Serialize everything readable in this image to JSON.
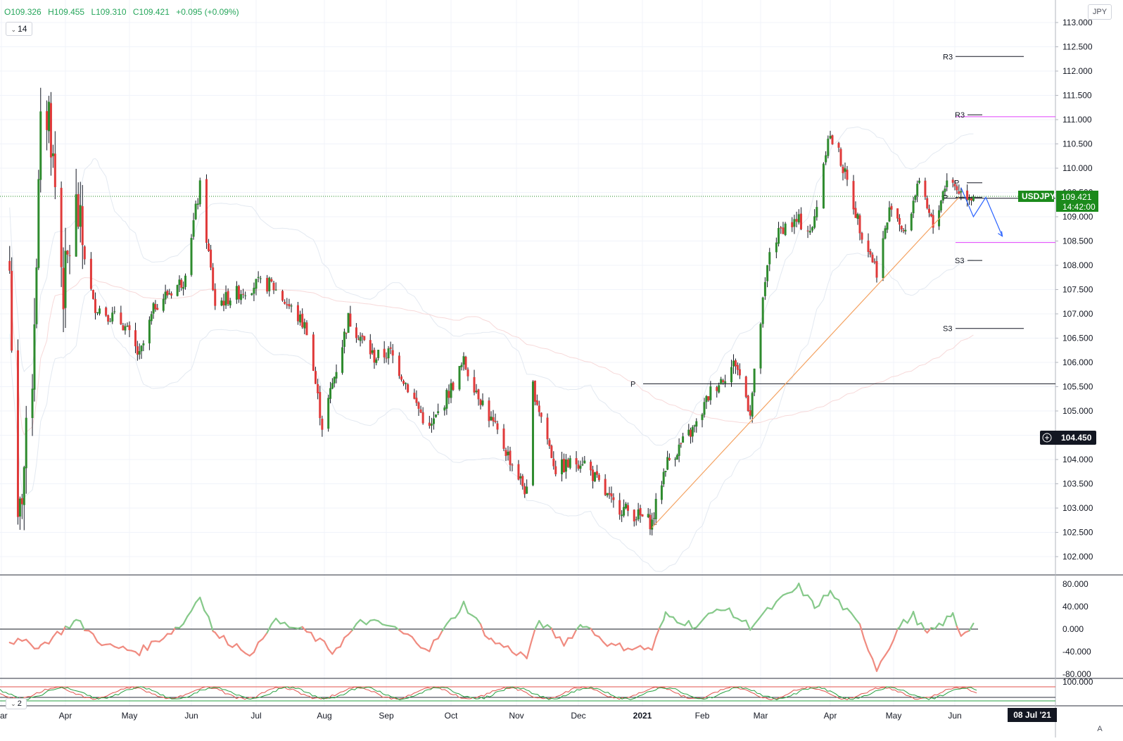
{
  "header": {
    "open": "O109.326",
    "high": "H109.455",
    "low": "L109.310",
    "close": "C109.421",
    "change": "+0.095 (+0.09%)",
    "period": "14",
    "currency": "JPY"
  },
  "colors": {
    "up": "#2e8b2e",
    "down": "#e03a3a",
    "trendline": "#f4a261",
    "projection": "#2962ff",
    "pivot_magenta": "#e040fb",
    "price_label_bg": "#1b8a1b",
    "rsi_up": "#86c98a",
    "rsi_down": "#f08b80"
  },
  "price_axis": {
    "ticks": [
      "113.000",
      "112.500",
      "112.000",
      "111.500",
      "111.000",
      "110.500",
      "110.000",
      "109.500",
      "109.000",
      "108.500",
      "108.000",
      "107.500",
      "107.000",
      "106.500",
      "106.000",
      "105.500",
      "105.000",
      "104.500",
      "104.000",
      "103.500",
      "103.000",
      "102.500",
      "102.000"
    ],
    "last_symbol": "USDJPY",
    "last_price": "109.421",
    "countdown": "14:42:00",
    "crosshair_price": "104.450"
  },
  "time_axis": {
    "labels": [
      "ar",
      "Apr",
      "May",
      "Jun",
      "Jul",
      "Aug",
      "Sep",
      "Oct",
      "Nov",
      "Dec",
      "2021",
      "Feb",
      "Mar",
      "Apr",
      "May",
      "Jun"
    ],
    "crosshair_date": "08 Jul '21"
  },
  "pivot_labels": {
    "r3_upper": "R3",
    "r3_lower": "R3",
    "p_near": "P",
    "p_near2": "P",
    "s3_upper": "S3",
    "p_long": "P",
    "s3_lower": "S3"
  },
  "rsi_panel": {
    "ticks": [
      "80.000",
      "40.000",
      "0.000",
      "-40.000",
      "-80.000"
    ]
  },
  "lower_panel": {
    "period": "2",
    "ticks": [
      "100.000"
    ],
    "auto_label": "A"
  },
  "chart_data": {
    "type": "candlestick",
    "symbol": "USDJPY",
    "interval": "1D",
    "ylim": [
      101.6,
      113.2
    ],
    "ohlc_last": {
      "open": 109.326,
      "high": 109.455,
      "low": 109.31,
      "close": 109.421
    },
    "months": [
      {
        "label": "Apr",
        "date": "2020-04"
      },
      {
        "label": "May",
        "date": "2020-05"
      },
      {
        "label": "Jun",
        "date": "2020-06"
      },
      {
        "label": "Jul",
        "date": "2020-07"
      },
      {
        "label": "Aug",
        "date": "2020-08"
      },
      {
        "label": "Sep",
        "date": "2020-09"
      },
      {
        "label": "Oct",
        "date": "2020-10"
      },
      {
        "label": "Nov",
        "date": "2020-11"
      },
      {
        "label": "Dec",
        "date": "2020-12"
      },
      {
        "label": "2021",
        "date": "2021-01"
      },
      {
        "label": "Feb",
        "date": "2021-02"
      },
      {
        "label": "Mar",
        "date": "2021-03"
      },
      {
        "label": "Apr",
        "date": "2021-04"
      },
      {
        "label": "May",
        "date": "2021-05"
      },
      {
        "label": "Jun",
        "date": "2021-06"
      }
    ],
    "close_path": [
      {
        "date": "2020-03-05",
        "close": 107.9
      },
      {
        "date": "2020-03-09",
        "close": 102.4
      },
      {
        "date": "2020-03-16",
        "close": 105.8
      },
      {
        "date": "2020-03-20",
        "close": 110.7
      },
      {
        "date": "2020-03-24",
        "close": 111.2
      },
      {
        "date": "2020-03-31",
        "close": 107.5
      },
      {
        "date": "2020-04-06",
        "close": 109.2
      },
      {
        "date": "2020-04-14",
        "close": 107.2
      },
      {
        "date": "2020-04-28",
        "close": 106.8
      },
      {
        "date": "2020-05-06",
        "close": 106.1
      },
      {
        "date": "2020-05-14",
        "close": 107.2
      },
      {
        "date": "2020-05-28",
        "close": 107.7
      },
      {
        "date": "2020-06-05",
        "close": 109.6
      },
      {
        "date": "2020-06-12",
        "close": 107.2
      },
      {
        "date": "2020-06-30",
        "close": 107.6
      },
      {
        "date": "2020-07-08",
        "close": 107.6
      },
      {
        "date": "2020-07-24",
        "close": 106.7
      },
      {
        "date": "2020-07-31",
        "close": 104.7
      },
      {
        "date": "2020-08-13",
        "close": 106.9
      },
      {
        "date": "2020-08-26",
        "close": 106.1
      },
      {
        "date": "2020-09-03",
        "close": 106.2
      },
      {
        "date": "2020-09-21",
        "close": 104.6
      },
      {
        "date": "2020-10-07",
        "close": 106.0
      },
      {
        "date": "2020-10-20",
        "close": 104.8
      },
      {
        "date": "2020-11-06",
        "close": 103.3
      },
      {
        "date": "2020-11-09",
        "close": 105.5
      },
      {
        "date": "2020-11-20",
        "close": 103.8
      },
      {
        "date": "2020-12-03",
        "close": 104.0
      },
      {
        "date": "2020-12-17",
        "close": 103.1
      },
      {
        "date": "2021-01-06",
        "close": 102.7
      },
      {
        "date": "2021-01-13",
        "close": 103.9
      },
      {
        "date": "2021-01-29",
        "close": 104.7
      },
      {
        "date": "2021-02-05",
        "close": 105.4
      },
      {
        "date": "2021-02-17",
        "close": 106.0
      },
      {
        "date": "2021-02-24",
        "close": 105.0
      },
      {
        "date": "2021-03-05",
        "close": 108.3
      },
      {
        "date": "2021-03-11",
        "close": 108.8
      },
      {
        "date": "2021-03-18",
        "close": 108.9
      },
      {
        "date": "2021-03-24",
        "close": 108.7
      },
      {
        "date": "2021-03-31",
        "close": 110.7
      },
      {
        "date": "2021-04-05",
        "close": 110.3
      },
      {
        "date": "2021-04-15",
        "close": 108.8
      },
      {
        "date": "2021-04-23",
        "close": 107.9
      },
      {
        "date": "2021-04-30",
        "close": 109.3
      },
      {
        "date": "2021-05-07",
        "close": 108.6
      },
      {
        "date": "2021-05-13",
        "close": 109.7
      },
      {
        "date": "2021-05-21",
        "close": 108.8
      },
      {
        "date": "2021-05-28",
        "close": 109.8
      },
      {
        "date": "2021-06-04",
        "close": 109.5
      },
      {
        "date": "2021-06-10",
        "close": 109.421
      }
    ],
    "rsi_path": [
      {
        "date": "2020-03-05",
        "value": -20
      },
      {
        "date": "2020-03-20",
        "value": -30
      },
      {
        "date": "2020-04-06",
        "value": 15
      },
      {
        "date": "2020-04-20",
        "value": -30
      },
      {
        "date": "2020-05-06",
        "value": -40
      },
      {
        "date": "2020-05-28",
        "value": 10
      },
      {
        "date": "2020-06-05",
        "value": 60
      },
      {
        "date": "2020-06-12",
        "value": -10
      },
      {
        "date": "2020-06-30",
        "value": -45
      },
      {
        "date": "2020-07-08",
        "value": 15
      },
      {
        "date": "2020-07-24",
        "value": -5
      },
      {
        "date": "2020-08-05",
        "value": -40
      },
      {
        "date": "2020-08-20",
        "value": 15
      },
      {
        "date": "2020-09-03",
        "value": 5
      },
      {
        "date": "2020-09-21",
        "value": -35
      },
      {
        "date": "2020-10-07",
        "value": 45
      },
      {
        "date": "2020-10-20",
        "value": -20
      },
      {
        "date": "2020-11-06",
        "value": -50
      },
      {
        "date": "2020-11-12",
        "value": 15
      },
      {
        "date": "2020-11-24",
        "value": -25
      },
      {
        "date": "2020-12-03",
        "value": 10
      },
      {
        "date": "2020-12-17",
        "value": -30
      },
      {
        "date": "2021-01-06",
        "value": -35
      },
      {
        "date": "2021-01-13",
        "value": 25
      },
      {
        "date": "2021-01-29",
        "value": 5
      },
      {
        "date": "2021-02-10",
        "value": 40
      },
      {
        "date": "2021-02-24",
        "value": 5
      },
      {
        "date": "2021-03-11",
        "value": 55
      },
      {
        "date": "2021-03-18",
        "value": 75
      },
      {
        "date": "2021-03-25",
        "value": 40
      },
      {
        "date": "2021-04-01",
        "value": 65
      },
      {
        "date": "2021-04-15",
        "value": 5
      },
      {
        "date": "2021-04-23",
        "value": -70
      },
      {
        "date": "2021-05-04",
        "value": 5
      },
      {
        "date": "2021-05-11",
        "value": 25
      },
      {
        "date": "2021-05-18",
        "value": -10
      },
      {
        "date": "2021-05-31",
        "value": 25
      },
      {
        "date": "2021-06-04",
        "value": -10
      },
      {
        "date": "2021-06-10",
        "value": 10
      }
    ],
    "pivots": [
      {
        "label": "R3",
        "value": 112.3
      },
      {
        "label": "R3",
        "value": 111.1
      },
      {
        "label": "P",
        "value": 109.7
      },
      {
        "label": "P",
        "value": 109.4
      },
      {
        "label": "S3",
        "value": 108.1
      },
      {
        "label": "P",
        "value": 105.56
      },
      {
        "label": "S3",
        "value": 106.7
      }
    ],
    "horizontal_lines": [
      {
        "value": 111.06,
        "color": "#e040fb"
      },
      {
        "value": 108.47,
        "color": "#e040fb"
      },
      {
        "value": 109.38,
        "color": "#131722"
      },
      {
        "value": 105.56,
        "color": "#131722"
      }
    ],
    "trendline": {
      "start": {
        "date": "2021-01-06",
        "price": 102.6
      },
      "end": {
        "date": "2021-06-03",
        "price": 109.4
      }
    },
    "projection": [
      {
        "date": "2021-06-04",
        "price": 109.6
      },
      {
        "date": "2021-06-10",
        "price": 109.0
      },
      {
        "date": "2021-06-16",
        "price": 109.4
      },
      {
        "date": "2021-06-24",
        "price": 108.6
      }
    ]
  }
}
